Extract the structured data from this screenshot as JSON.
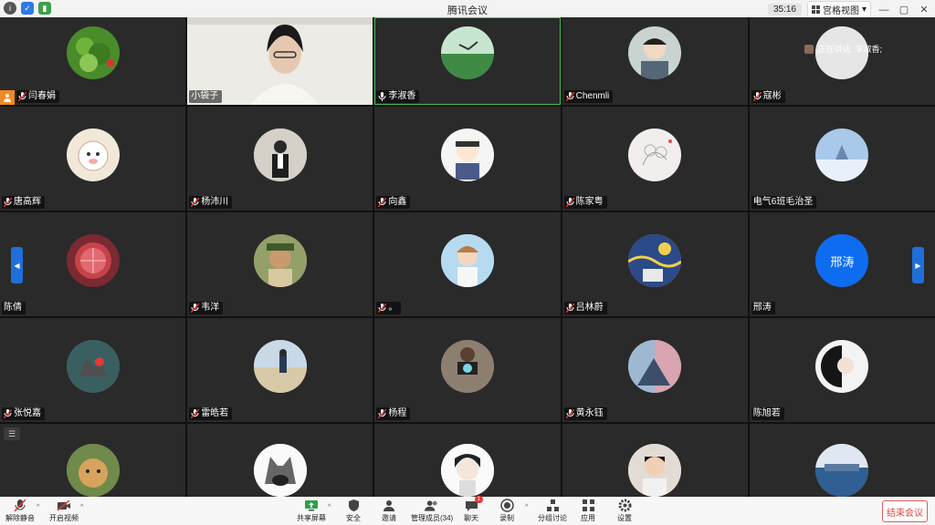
{
  "window": {
    "title": "腾讯会议",
    "timer": "35:16",
    "view_label": "宫格视图"
  },
  "speaking_now": "正在讲话: 李淑香;",
  "participants": [
    {
      "name": "闫春娟",
      "avatar": "plant",
      "color": "#4a8c2a",
      "row": 0
    },
    {
      "name": "小袋子",
      "avatar": "video",
      "row": 0
    },
    {
      "name": "李淑香",
      "avatar": "bird",
      "color": "#5fa86a",
      "row": 0,
      "active": true
    },
    {
      "name": "Chenmli",
      "avatar": "boy",
      "color": "#c9d4d0",
      "row": 0
    },
    {
      "name": "寇彬",
      "avatar": "blank",
      "color": "#e3e3e3",
      "row": 0
    },
    {
      "name": "唐高辉",
      "avatar": "sheep",
      "color": "#f2e8d9",
      "row": 1
    },
    {
      "name": "杨沛川",
      "avatar": "person",
      "color": "#c8c2b8",
      "row": 1
    },
    {
      "name": "向鑫",
      "avatar": "cartoon",
      "color": "#f5f5f5",
      "row": 1
    },
    {
      "name": "陈家粤",
      "avatar": "sketch",
      "color": "#f3eeee",
      "row": 1
    },
    {
      "name": "电气6班毛治圣",
      "avatar": "snow",
      "color": "#a9c9ea",
      "row": 1
    },
    {
      "name": "陈倩",
      "avatar": "fruit",
      "color": "#7a2a30",
      "row": 2
    },
    {
      "name": "韦洋",
      "avatar": "dog",
      "color": "#6e7a52",
      "row": 2
    },
    {
      "name": "。",
      "avatar": "anime",
      "color": "#a6cde6",
      "row": 2
    },
    {
      "name": "吕林蔚",
      "avatar": "starry",
      "color": "#d9b63a",
      "row": 2
    },
    {
      "name": "邢涛",
      "avatar": "text",
      "text": "邢涛",
      "row": 2
    },
    {
      "name": "张悦嘉",
      "avatar": "cat",
      "color": "#3f6a6a",
      "row": 3
    },
    {
      "name": "雷皓若",
      "avatar": "beach",
      "color": "#b9c8d6",
      "row": 3
    },
    {
      "name": "杨程",
      "avatar": "camera",
      "color": "#7d7368",
      "row": 3
    },
    {
      "name": "黄永钰",
      "avatar": "art",
      "color": "#8aa0b8",
      "row": 3
    },
    {
      "name": "陈旭若",
      "avatar": "girl",
      "color": "#2a2a2a",
      "row": 3
    },
    {
      "name": "",
      "avatar": "cat2",
      "color": "#b7853a",
      "row": 4
    },
    {
      "name": "",
      "avatar": "wolf",
      "color": "#f0f0f0",
      "row": 4
    },
    {
      "name": "",
      "avatar": "chibi",
      "color": "#f3f0f0",
      "row": 4
    },
    {
      "name": "",
      "avatar": "kid",
      "color": "#e0d6cf",
      "row": 4
    },
    {
      "name": "",
      "avatar": "sea",
      "color": "#6d8fb0",
      "row": 4
    }
  ],
  "toolbar": {
    "unmute": "解除静音",
    "video": "开启视频",
    "share": "共享屏幕",
    "security": "安全",
    "invite": "邀请",
    "members": "管理成员(34)",
    "chat": "聊天",
    "chat_badge": "1",
    "record": "录制",
    "breakout": "分组讨论",
    "apps": "应用",
    "settings": "设置",
    "end": "结束会议"
  }
}
